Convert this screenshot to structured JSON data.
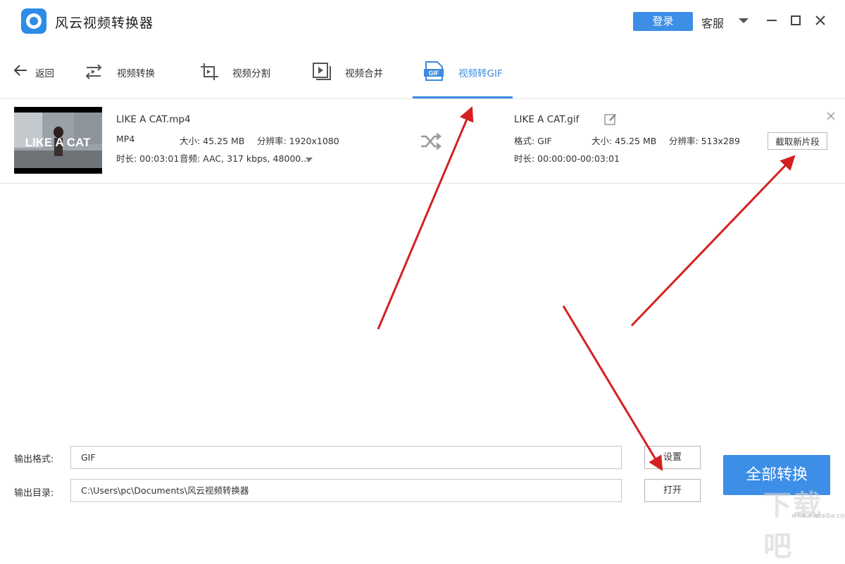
{
  "app": {
    "title": "风云视频转换器",
    "login_label": "登录",
    "service_label": "客服"
  },
  "colors": {
    "accent": "#3b8be0",
    "annotation_arrow": "#d42020"
  },
  "tabs": [
    {
      "label": "返回",
      "icon": "back-arrow-icon"
    },
    {
      "label": "视频转换",
      "icon": "video-convert-icon"
    },
    {
      "label": "视频分割",
      "icon": "video-crop-icon"
    },
    {
      "label": "视频合并",
      "icon": "video-merge-icon"
    },
    {
      "label": "视频转GIF",
      "icon": "gif-file-icon",
      "active": true
    }
  ],
  "source": {
    "filename": "LIKE A CAT.mp4",
    "format": "MP4",
    "size": "大小: 45.25 MB",
    "resolution": "分辨率: 1920x1080",
    "duration": "时长: 00:03:01",
    "audio": "音频: AAC, 317 kbps, 48000...",
    "thumbnail_text": "LIKE A CAT"
  },
  "output": {
    "filename": "LIKE A CAT.gif",
    "format": "格式: GIF",
    "size": "大小: 45.25 MB",
    "resolution": "分辨率: 513x289",
    "duration": "时长: 00:00:00-00:03:01",
    "clip_button": "截取新片段"
  },
  "bottom": {
    "format_label": "输出格式:",
    "format_value": "GIF",
    "settings_button": "设置",
    "dir_label": "输出目录:",
    "dir_value": "C:\\Users\\pc\\Documents\\风云视频转换器",
    "open_button": "打开",
    "convert_all": "全部转换"
  },
  "watermark": {
    "text": "下载吧",
    "url": "www.xiazaiba.com"
  }
}
